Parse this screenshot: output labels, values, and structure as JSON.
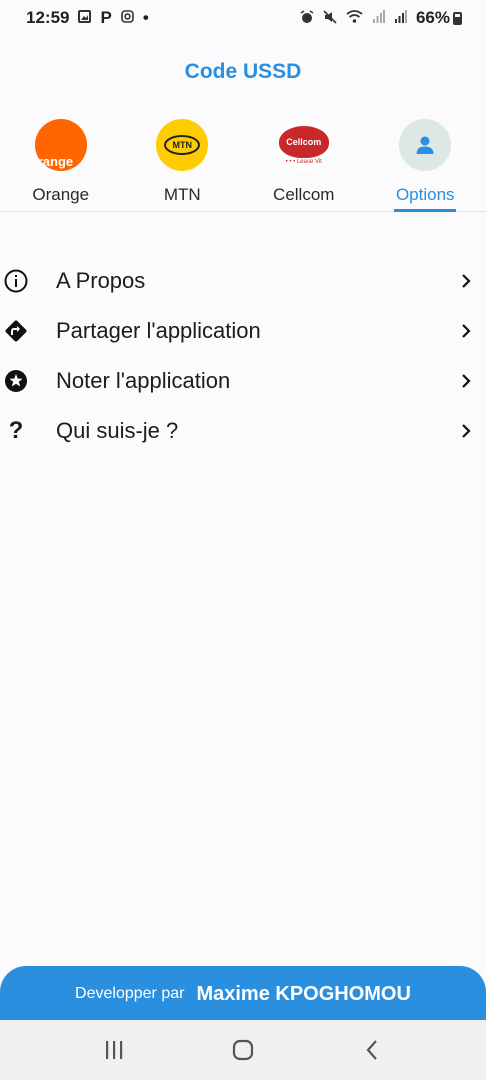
{
  "status_bar": {
    "time": "12:59",
    "left_icons": [
      "gallery-icon",
      "p-icon",
      "instagram-icon",
      "dot-icon"
    ],
    "p_letter": "P",
    "dot": "•",
    "right_icons": [
      "alarm-icon",
      "mute-icon",
      "wifi-icon",
      "signal-icon",
      "signal-icon",
      "battery-icon"
    ],
    "battery": "66%"
  },
  "header": {
    "title": "Code USSD"
  },
  "tabs": [
    {
      "label": "Orange",
      "icon": "orange-logo",
      "logo_text": "range",
      "active": false
    },
    {
      "label": "MTN",
      "icon": "mtn-logo",
      "logo_text": "MTN",
      "active": false
    },
    {
      "label": "Cellcom",
      "icon": "cellcom-logo",
      "logo_text": "Cellcom",
      "logo_sub": "• • • Lease Vit",
      "active": false
    },
    {
      "label": "Options",
      "icon": "person-icon",
      "active": true
    }
  ],
  "menu": {
    "items": [
      {
        "label": "A Propos",
        "icon": "info-icon"
      },
      {
        "label": "Partager l'application",
        "icon": "share-direction-icon"
      },
      {
        "label": "Noter l'application",
        "icon": "star-circle-icon"
      },
      {
        "label": "Qui suis-je ?",
        "icon": "question-mark-icon",
        "glyph": "?"
      }
    ]
  },
  "footer": {
    "prefix": "Developper par",
    "name": "Maxime KPOGHOMOU"
  },
  "colors": {
    "accent": "#2b8fe0",
    "background": "#fbfbfd",
    "orange": "#ff6600",
    "mtn": "#ffcc00",
    "cellcom": "#c8282a"
  }
}
